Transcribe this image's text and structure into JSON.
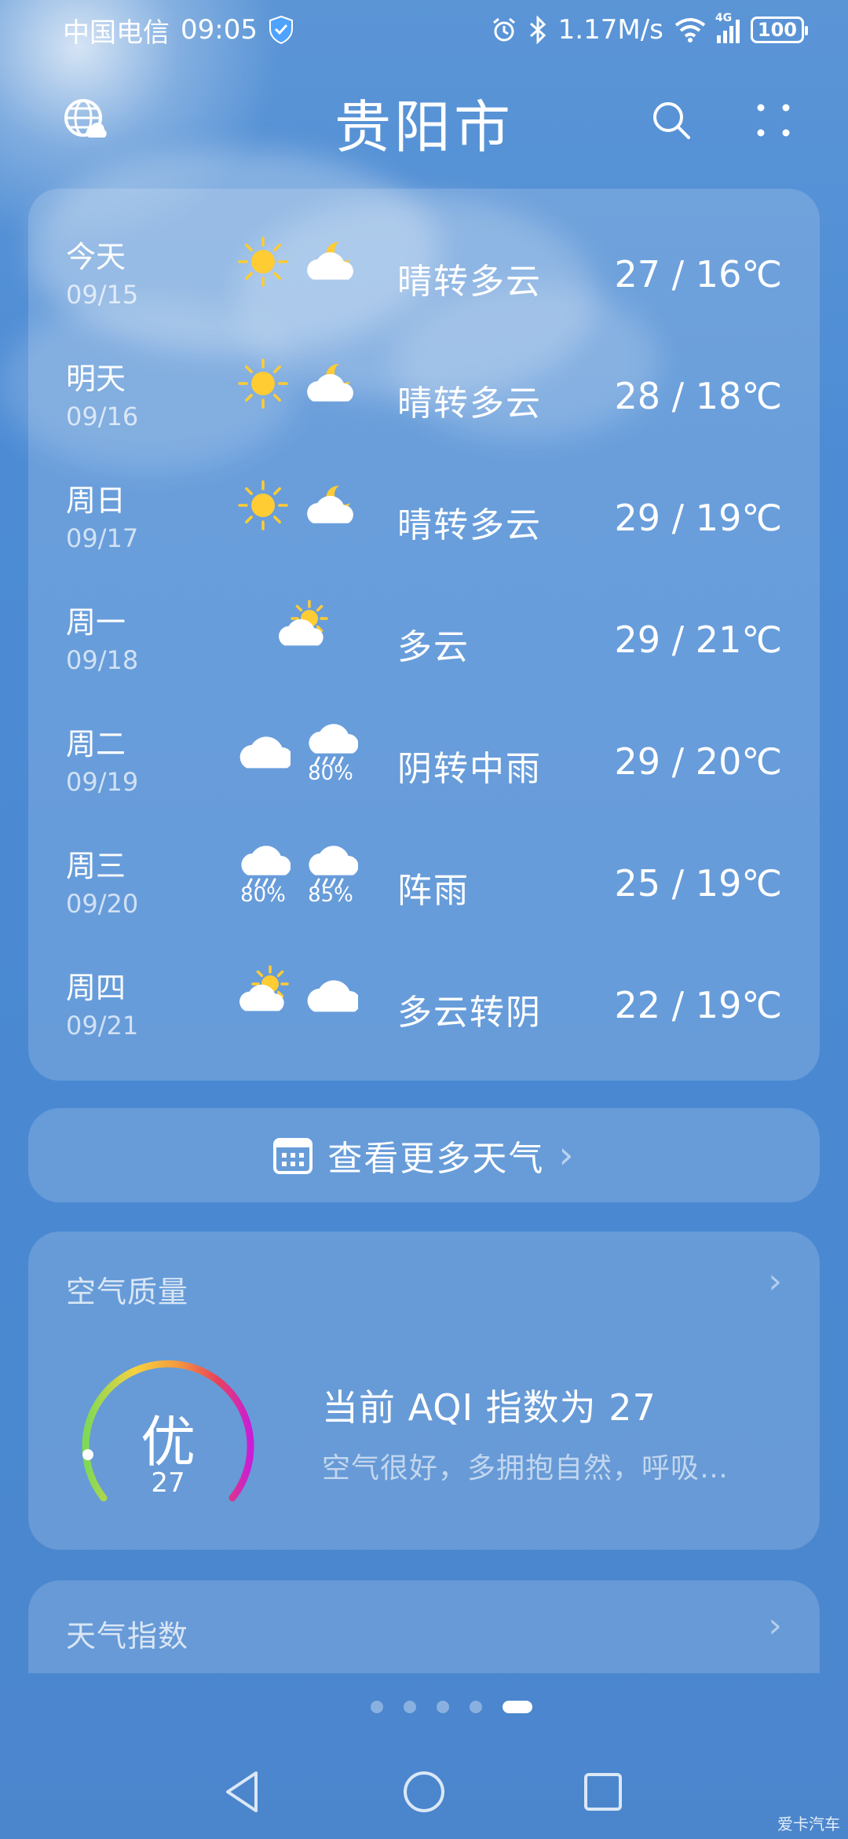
{
  "status_bar": {
    "carrier": "中国电信",
    "time": "09:05",
    "network_speed": "1.17M/s",
    "signal_label": "4G",
    "battery": "100"
  },
  "header": {
    "city": "贵阳市"
  },
  "forecast": [
    {
      "day": "今天",
      "date": "09/15",
      "icons": [
        "sunny",
        "partly-cloudy-night"
      ],
      "precip": [
        "",
        ""
      ],
      "condition": "晴转多云",
      "temp": "27 / 16℃"
    },
    {
      "day": "明天",
      "date": "09/16",
      "icons": [
        "sunny",
        "partly-cloudy-night"
      ],
      "precip": [
        "",
        ""
      ],
      "condition": "晴转多云",
      "temp": "28 / 18℃"
    },
    {
      "day": "周日",
      "date": "09/17",
      "icons": [
        "sunny",
        "partly-cloudy-night"
      ],
      "precip": [
        "",
        ""
      ],
      "condition": "晴转多云",
      "temp": "29 / 19℃"
    },
    {
      "day": "周一",
      "date": "09/18",
      "icons": [
        "partly-cloudy-day"
      ],
      "precip": [
        ""
      ],
      "condition": "多云",
      "temp": "29 / 21℃"
    },
    {
      "day": "周二",
      "date": "09/19",
      "icons": [
        "cloudy",
        "rain"
      ],
      "precip": [
        "",
        "80%"
      ],
      "condition": "阴转中雨",
      "temp": "29 / 20℃"
    },
    {
      "day": "周三",
      "date": "09/20",
      "icons": [
        "rain",
        "rain"
      ],
      "precip": [
        "80%",
        "85%"
      ],
      "condition": "阵雨",
      "temp": "25 / 19℃"
    },
    {
      "day": "周四",
      "date": "09/21",
      "icons": [
        "partly-cloudy-day",
        "cloudy"
      ],
      "precip": [
        "",
        ""
      ],
      "condition": "多云转阴",
      "temp": "22 / 19℃"
    }
  ],
  "more_weather": {
    "label": "查看更多天气"
  },
  "air_quality": {
    "title": "空气质量",
    "level": "优",
    "aqi": "27",
    "headline": "当前 AQI 指数为 27",
    "description": "空气很好，多拥抱自然，呼吸…"
  },
  "weather_index": {
    "title": "天气指数"
  },
  "pager": {
    "count": 5,
    "active": 4
  },
  "watermark": "爱卡汽车",
  "colors": {
    "sun": "#ffcc33",
    "aqi_gradient": [
      "#7ed957",
      "#f7d23e",
      "#f39c3d",
      "#e9425a",
      "#c81ed8"
    ]
  }
}
